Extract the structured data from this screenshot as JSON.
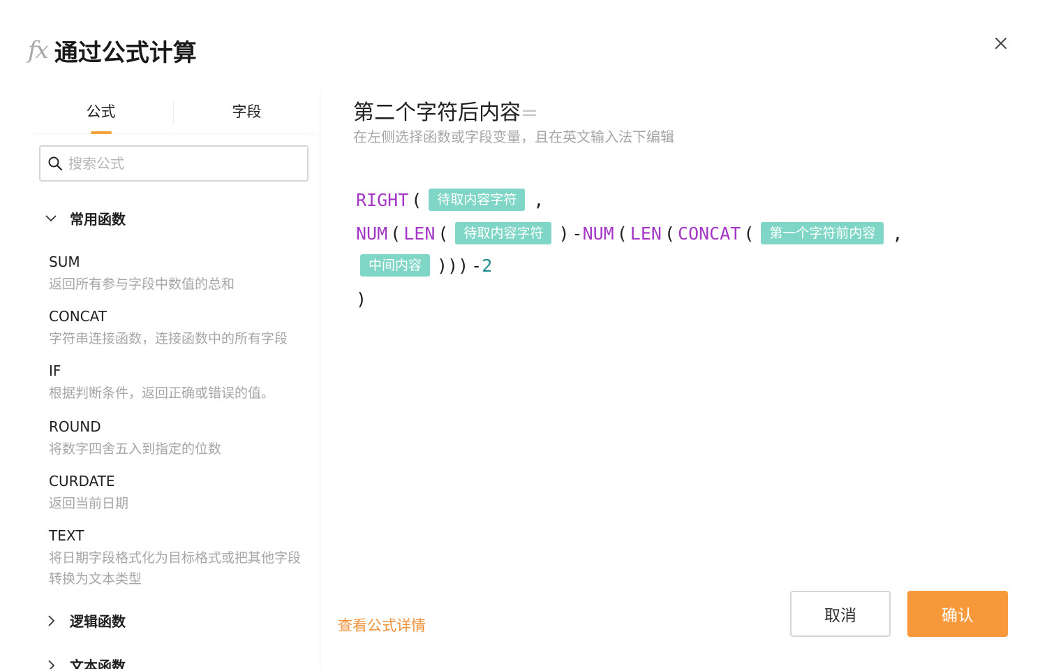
{
  "header": {
    "fx_label": "fx",
    "title": "通过公式计算"
  },
  "tabs": [
    {
      "label": "公式"
    },
    {
      "label": "字段"
    }
  ],
  "search": {
    "placeholder": "搜索公式",
    "value": ""
  },
  "groups": {
    "common": {
      "label": "常用函数",
      "expanded": true
    },
    "logic": {
      "label": "逻辑函数",
      "expanded": false
    },
    "text": {
      "label": "文本函数",
      "expanded": false
    }
  },
  "functions": [
    {
      "name": "SUM",
      "desc": "返回所有参与字段中数值的总和"
    },
    {
      "name": "CONCAT",
      "desc": "字符串连接函数，连接函数中的所有字段"
    },
    {
      "name": "IF",
      "desc": "根据判断条件，返回正确或错误的值。"
    },
    {
      "name": "ROUND",
      "desc": "将数字四舍五入到指定的位数"
    },
    {
      "name": "CURDATE",
      "desc": "返回当前日期"
    },
    {
      "name": "TEXT",
      "desc": "将日期字段格式化为目标格式或把其他字段转换为文本类型"
    }
  ],
  "editor": {
    "field_name": "第二个字符后内容",
    "equals": "=",
    "hint": "在左侧选择函数或字段变量，且在英文输入法下编辑",
    "tokens": {
      "right": "RIGHT",
      "num": "NUM",
      "len": "LEN",
      "concat": "CONCAT",
      "tag_source": "待取内容字符",
      "tag_first": "第一个字符前内容",
      "tag_middle": "中间内容",
      "open": "(",
      "close": ")",
      "close3": ")))",
      "comma": ",",
      "minus": "-",
      "two": "2"
    }
  },
  "footer": {
    "details_link": "查看公式详情",
    "cancel": "取消",
    "confirm": "确认"
  },
  "colors": {
    "accent": "#f7993b",
    "function_keyword": "#a537c6",
    "field_tag": "#7fd6c6"
  }
}
